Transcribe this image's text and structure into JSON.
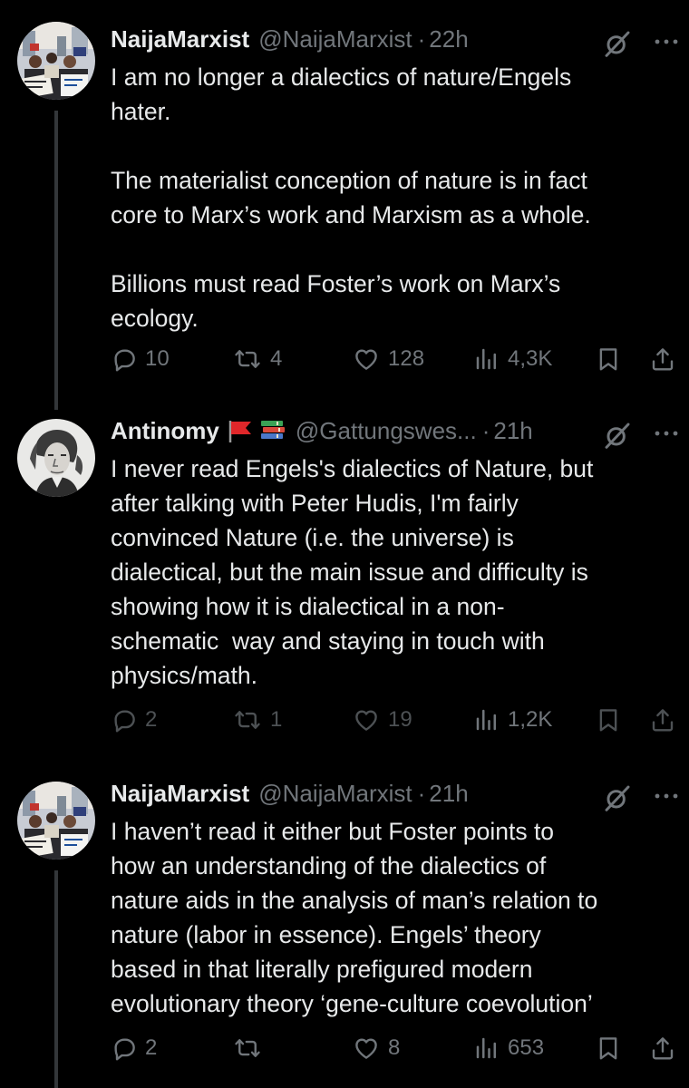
{
  "tweets": [
    {
      "name": "NaijaMarxist",
      "flags": "",
      "handle": "@NaijaMarxist",
      "time": "22h",
      "text": "I am no longer a dialectics of nature/Engels\nhater.\n\nThe materialist conception of nature is in fact\ncore to Marx’s work and Marxism as a whole.\n\nBillions must read Foster’s work on Marx’s\necology.",
      "replies": "10",
      "reposts": "4",
      "likes": "128",
      "views": "4,3K",
      "avatar": "protest-photo-avatar"
    },
    {
      "name": "Antinomy",
      "flags": "🚩📚",
      "handle": "@Gattungswes...",
      "time": "21h",
      "text": "I never read Engels's dialectics of Nature, but\nafter talking with Peter Hudis, I'm fairly\nconvinced Nature (i.e. the universe) is\ndialectical, but the main issue and difficulty is\nshowing how it is dialectical in a non-\nschematic  way and staying in touch with\nphysics/math.",
      "replies": "2",
      "reposts": "1",
      "likes": "19",
      "views": "1,2K",
      "avatar": "portrait-engraving-avatar"
    },
    {
      "name": "NaijaMarxist",
      "flags": "",
      "handle": "@NaijaMarxist",
      "time": "21h",
      "text": "I haven’t read it either but Foster points to\nhow an understanding of the dialectics of\nnature aids in the analysis of man’s relation to\nnature (labor in essence). Engels’ theory\nbased in that literally prefigured modern\nevolutionary theory ‘gene-culture coevolution’",
      "replies": "2",
      "reposts": "",
      "likes": "8",
      "views": "653",
      "avatar": "protest-photo-avatar"
    }
  ],
  "separator": "·",
  "colors": {
    "background": "#000000",
    "text": "#e7e9ea",
    "secondary": "#71767b",
    "thread_line": "#333639"
  },
  "icons": [
    "reply-icon",
    "repost-icon",
    "like-icon",
    "views-icon",
    "bookmark-icon",
    "share-icon",
    "grok-icon",
    "more-icon",
    "flag-emoji",
    "books-emoji"
  ]
}
